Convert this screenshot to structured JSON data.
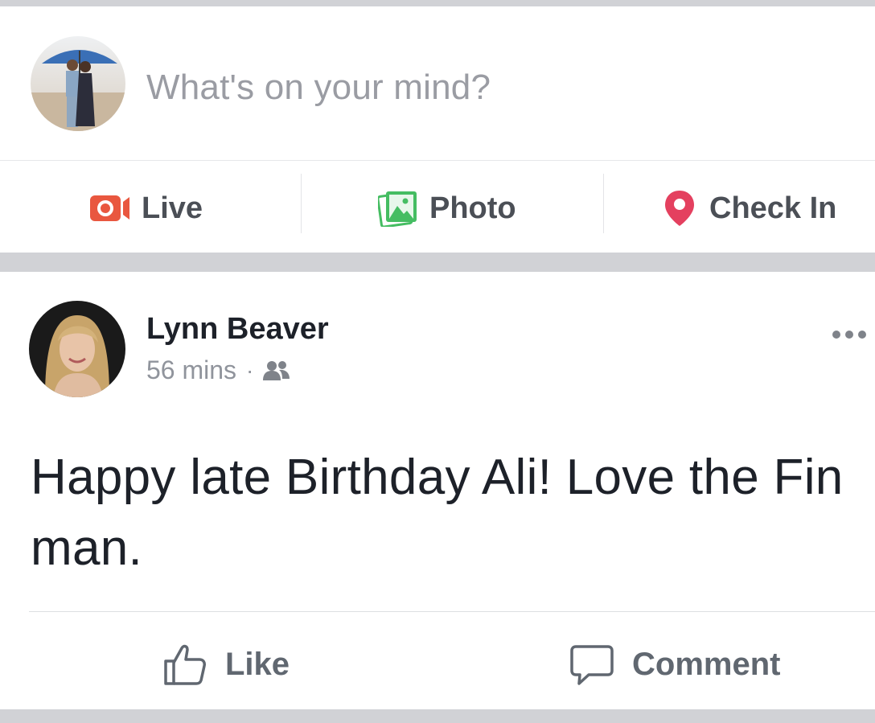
{
  "composer": {
    "prompt": "What's on your mind?",
    "actions": [
      {
        "label": "Live",
        "icon": "live-video-icon",
        "color": "#e9573f"
      },
      {
        "label": "Photo",
        "icon": "photo-icon",
        "color": "#45bd62"
      },
      {
        "label": "Check In",
        "icon": "map-pin-icon",
        "color": "#e4405f"
      }
    ]
  },
  "post": {
    "author": "Lynn Beaver",
    "time": "56 mins",
    "separator": "·",
    "audience_icon": "friends-icon",
    "text": "Happy late Birthday Ali! Love the Fin man.",
    "actions": [
      {
        "label": "Like",
        "icon": "thumbs-up-icon"
      },
      {
        "label": "Comment",
        "icon": "comment-icon"
      }
    ]
  },
  "colors": {
    "background": "#d1d2d6",
    "card": "#ffffff",
    "text_primary": "#1d2129",
    "text_secondary": "#90949c"
  }
}
